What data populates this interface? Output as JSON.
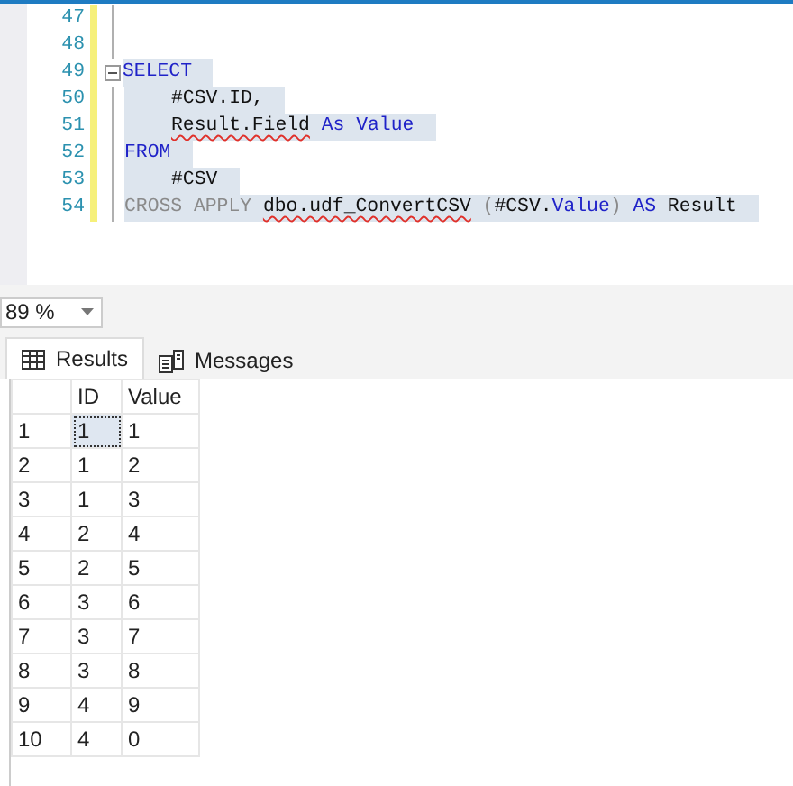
{
  "editor": {
    "lines": [
      {
        "number": "47",
        "selected": false,
        "fold": false
      },
      {
        "number": "48",
        "selected": false,
        "fold": false
      },
      {
        "number": "49",
        "selected": true,
        "fold": true,
        "indent": false,
        "tokens": [
          {
            "text": "SELECT",
            "kind": "keyword",
            "space_before": false,
            "squiggle": false
          }
        ]
      },
      {
        "number": "50",
        "selected": true,
        "fold": false,
        "indent": true,
        "tokens": [
          {
            "text": "#CSV.ID,",
            "kind": "plain",
            "space_before": false,
            "squiggle": false
          }
        ]
      },
      {
        "number": "51",
        "selected": true,
        "fold": false,
        "indent": true,
        "tokens": [
          {
            "text": "Result.Field",
            "kind": "plain",
            "space_before": false,
            "squiggle": true
          },
          {
            "text": "As",
            "kind": "keyword",
            "space_before": true,
            "squiggle": false
          },
          {
            "text": "Value",
            "kind": "keyword",
            "space_before": true,
            "squiggle": false
          }
        ]
      },
      {
        "number": "52",
        "selected": true,
        "fold": false,
        "indent": false,
        "tokens": [
          {
            "text": "FROM",
            "kind": "keyword",
            "space_before": false,
            "squiggle": false
          }
        ]
      },
      {
        "number": "53",
        "selected": true,
        "fold": false,
        "indent": true,
        "tokens": [
          {
            "text": "#CSV",
            "kind": "plain",
            "space_before": false,
            "squiggle": false
          }
        ]
      },
      {
        "number": "54",
        "selected": true,
        "fold": false,
        "indent": false,
        "tokens": [
          {
            "text": "CROSS APPLY",
            "kind": "operator",
            "space_before": false,
            "squiggle": false
          },
          {
            "text": "dbo.udf_ConvertCSV",
            "kind": "plain",
            "space_before": true,
            "squiggle": true
          },
          {
            "text": "(",
            "kind": "operator",
            "space_before": true,
            "squiggle": false
          },
          {
            "text": "#CSV.",
            "kind": "plain",
            "space_before": false,
            "squiggle": false
          },
          {
            "text": "Value",
            "kind": "keyword",
            "space_before": false,
            "squiggle": false
          },
          {
            "text": ")",
            "kind": "operator",
            "space_before": false,
            "squiggle": false
          },
          {
            "text": "AS",
            "kind": "keyword",
            "space_before": true,
            "squiggle": false
          },
          {
            "text": "Result",
            "kind": "plain",
            "space_before": true,
            "squiggle": false
          }
        ]
      }
    ]
  },
  "zoom": {
    "value": "89 %"
  },
  "tabs": [
    {
      "label": "Results",
      "selected": true
    },
    {
      "label": "Messages",
      "selected": false
    }
  ],
  "grid": {
    "columns": [
      "ID",
      "Value"
    ],
    "rows": [
      {
        "number": "1",
        "cells": [
          {
            "text": "1",
            "selected": true
          },
          {
            "text": "1",
            "selected": false
          }
        ]
      },
      {
        "number": "2",
        "cells": [
          {
            "text": "1",
            "selected": false
          },
          {
            "text": "2",
            "selected": false
          }
        ]
      },
      {
        "number": "3",
        "cells": [
          {
            "text": "1",
            "selected": false
          },
          {
            "text": "3",
            "selected": false
          }
        ]
      },
      {
        "number": "4",
        "cells": [
          {
            "text": "2",
            "selected": false
          },
          {
            "text": "4",
            "selected": false
          }
        ]
      },
      {
        "number": "5",
        "cells": [
          {
            "text": "2",
            "selected": false
          },
          {
            "text": "5",
            "selected": false
          }
        ]
      },
      {
        "number": "6",
        "cells": [
          {
            "text": "3",
            "selected": false
          },
          {
            "text": "6",
            "selected": false
          }
        ]
      },
      {
        "number": "7",
        "cells": [
          {
            "text": "3",
            "selected": false
          },
          {
            "text": "7",
            "selected": false
          }
        ]
      },
      {
        "number": "8",
        "cells": [
          {
            "text": "3",
            "selected": false
          },
          {
            "text": "8",
            "selected": false
          }
        ]
      },
      {
        "number": "9",
        "cells": [
          {
            "text": "4",
            "selected": false
          },
          {
            "text": "9",
            "selected": false
          }
        ]
      },
      {
        "number": "10",
        "cells": [
          {
            "text": "4",
            "selected": false
          },
          {
            "text": "0",
            "selected": false
          }
        ]
      }
    ]
  }
}
